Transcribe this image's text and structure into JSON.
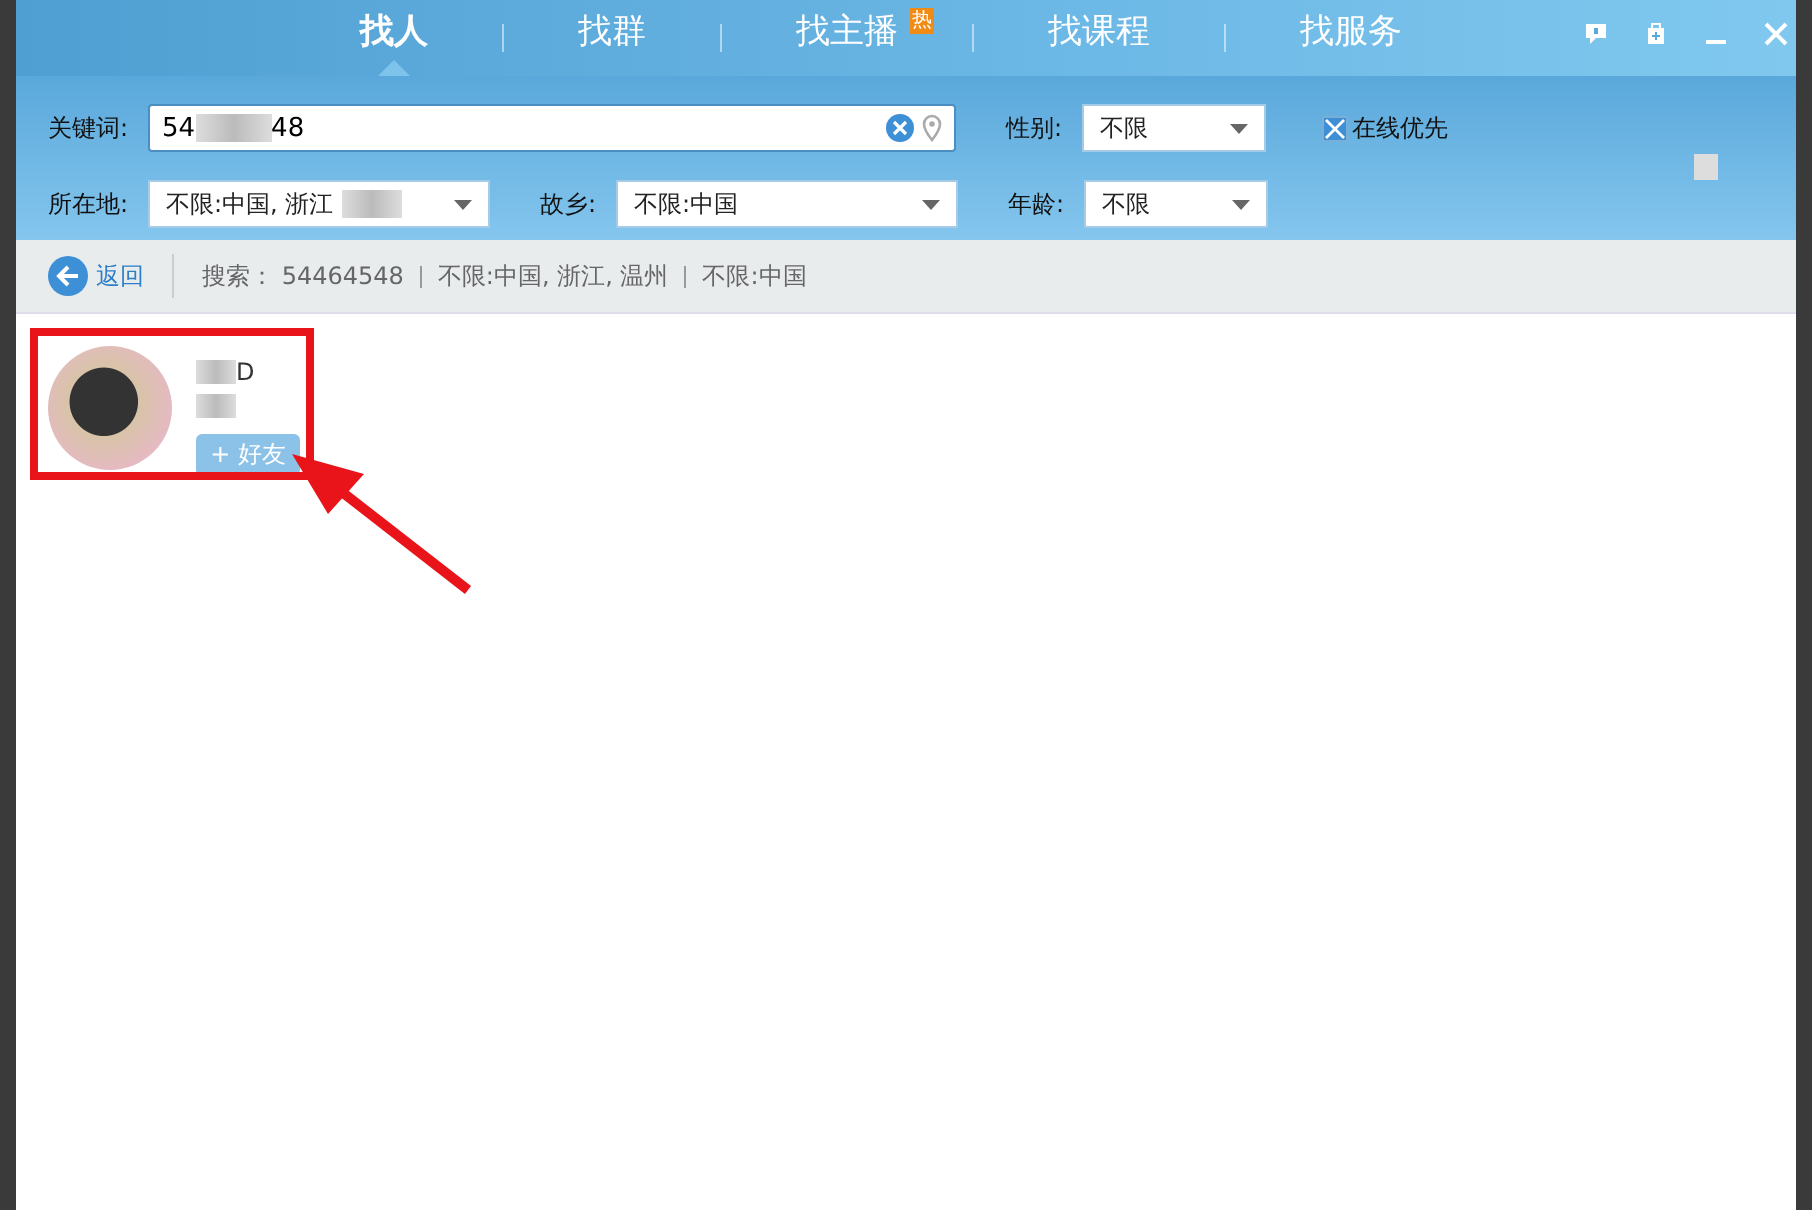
{
  "tabs": [
    {
      "label": "找人",
      "selected": true
    },
    {
      "label": "找群",
      "selected": false
    },
    {
      "label": "找主播",
      "selected": false,
      "badge": "热"
    },
    {
      "label": "找课程",
      "selected": false
    },
    {
      "label": "找服务",
      "selected": false
    }
  ],
  "filters": {
    "keyword": {
      "label": "关键词:",
      "value_start": "54",
      "value_end": "48"
    },
    "gender": {
      "label": "性别:",
      "value": "不限"
    },
    "online_first": {
      "label": "在线优先",
      "checked": true
    },
    "location": {
      "label": "所在地:",
      "value": "不限:中国, 浙江"
    },
    "hometown": {
      "label": "故乡:",
      "value": "不限:中国"
    },
    "age": {
      "label": "年龄:",
      "value": "不限"
    }
  },
  "breadcrumb": {
    "back": "返回",
    "summary": "搜索： 54464548",
    "parts": [
      "不限:中国, 浙江, 温州",
      "不限:中国"
    ]
  },
  "results": [
    {
      "name_tail": "D",
      "add_button": "+ 好友"
    }
  ]
}
